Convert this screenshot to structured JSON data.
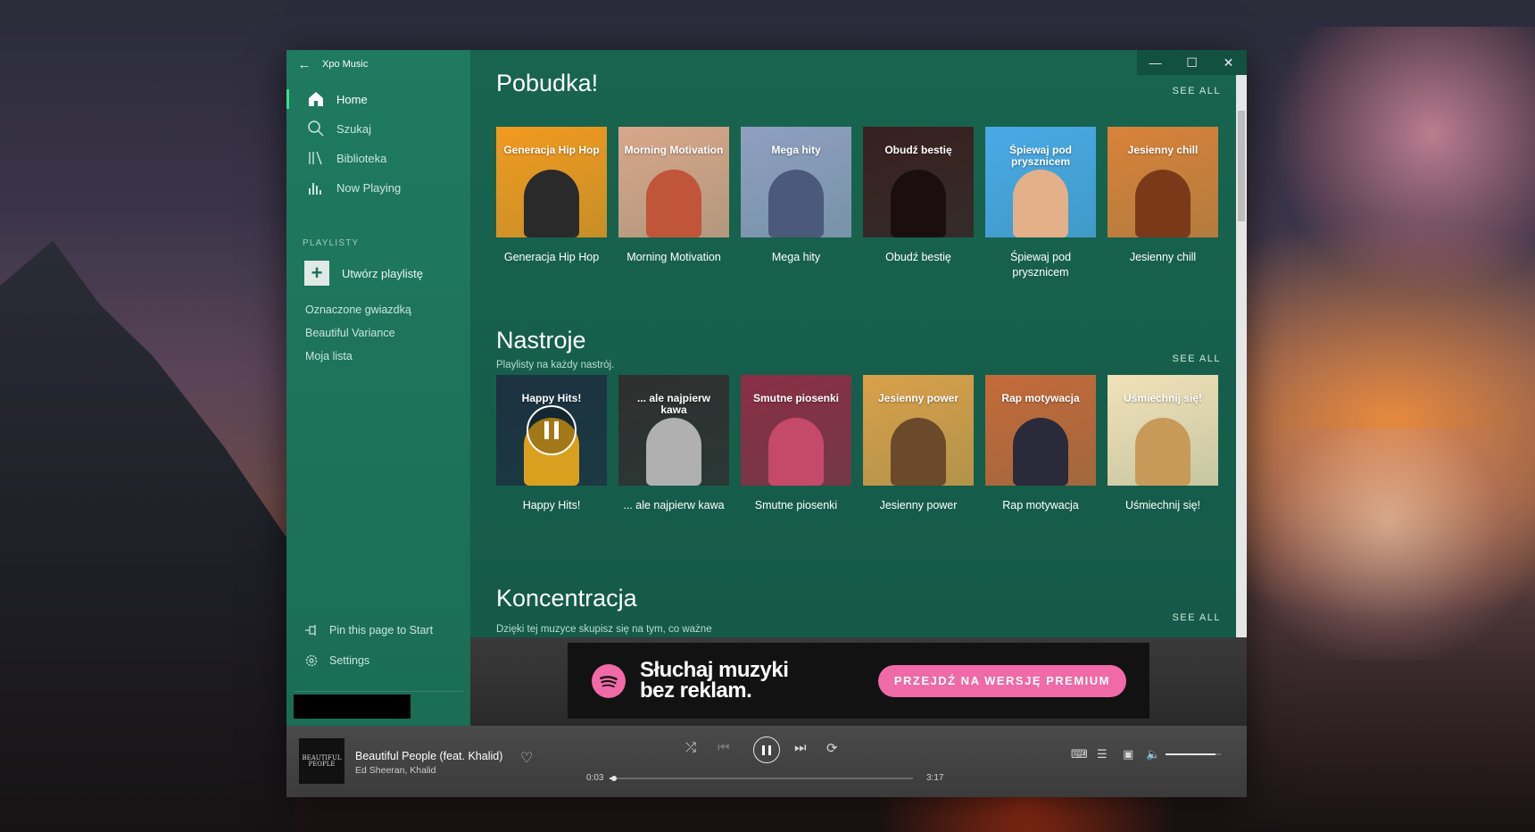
{
  "app": {
    "title": "Xpo Music"
  },
  "sidebar": {
    "nav": [
      {
        "label": "Home",
        "icon": "home-icon",
        "active": true
      },
      {
        "label": "Szukaj",
        "icon": "search-icon",
        "active": false
      },
      {
        "label": "Biblioteka",
        "icon": "library-icon",
        "active": false
      },
      {
        "label": "Now Playing",
        "icon": "equalizer-icon",
        "active": false
      }
    ],
    "section_label": "PLAYLISTY",
    "create_playlist": "Utwórz playlistę",
    "playlists": [
      "Oznaczone gwiazdką",
      "Beautiful Variance",
      "Moja lista"
    ],
    "pin_label": "Pin this page to Start",
    "settings_label": "Settings"
  },
  "sections": [
    {
      "title": "Pobudka!",
      "subtitle": "",
      "see_all": "SEE ALL",
      "cards": [
        {
          "art_text": "Generacja Hip Hop",
          "caption": "Generacja Hip Hop",
          "bg": "#f29a1f",
          "figure": "#2a2a2a"
        },
        {
          "art_text": "Morning Motivation",
          "caption": "Morning Motivation",
          "bg": "#d9a68a",
          "figure": "#c0553a"
        },
        {
          "art_text": "Mega hity",
          "caption": "Mega hity",
          "bg": "#8f9fc0",
          "figure": "#4b5a7a"
        },
        {
          "art_text": "Obudź bestię",
          "caption": "Obudź bestię",
          "bg": "#3a1f20",
          "figure": "#1a0e0e"
        },
        {
          "art_text": "Śpiewaj pod prysznicem",
          "caption": "Śpiewaj pod prysznicem",
          "bg": "#4aa9e6",
          "figure": "#e3b08a"
        },
        {
          "art_text": "Jesienny chill",
          "caption": "Jesienny chill",
          "bg": "#d9823a",
          "figure": "#7a3a1a"
        }
      ]
    },
    {
      "title": "Nastroje",
      "subtitle": "Playlisty na każdy nastrój.",
      "see_all": "SEE ALL",
      "cards": [
        {
          "art_text": "Happy Hits!",
          "caption": "Happy Hits!",
          "bg": "#1c3140",
          "figure": "#d9a020"
        },
        {
          "art_text": "... ale najpierw kawa",
          "caption": "... ale najpierw kawa",
          "bg": "#2f2f2f",
          "figure": "#b0b0b0"
        },
        {
          "art_text": "Smutne piosenki",
          "caption": "Smutne piosenki",
          "bg": "#8a2f45",
          "figure": "#c54a6a"
        },
        {
          "art_text": "Jesienny power",
          "caption": "Jesienny power",
          "bg": "#d9a04a",
          "figure": "#6a4a2a"
        },
        {
          "art_text": "Rap motywacja",
          "caption": "Rap motywacja",
          "bg": "#c46a3a",
          "figure": "#2a2a3a"
        },
        {
          "art_text": "Uśmiechnij się!",
          "caption": "Uśmiechnij się!",
          "bg": "#f2e1b8",
          "figure": "#c79a5a"
        }
      ]
    },
    {
      "title": "Koncentracja",
      "subtitle": "Dzięki tej muzyce skupisz się na tym, co ważne",
      "see_all": "SEE ALL",
      "cards": []
    }
  ],
  "ad": {
    "line1": "Słuchaj muzyki",
    "line2": "bez reklam.",
    "cta": "PRZEJDŹ NA WERSJĘ PREMIUM",
    "accent": "#f06aa8"
  },
  "player": {
    "art_text": "BEAUTIFUL PEOPLE",
    "title": "Beautiful People (feat. Khalid)",
    "artist": "Ed Sheeran, Khalid",
    "elapsed": "0:03",
    "duration": "3:17",
    "progress": 0.015,
    "volume": 0.9
  }
}
